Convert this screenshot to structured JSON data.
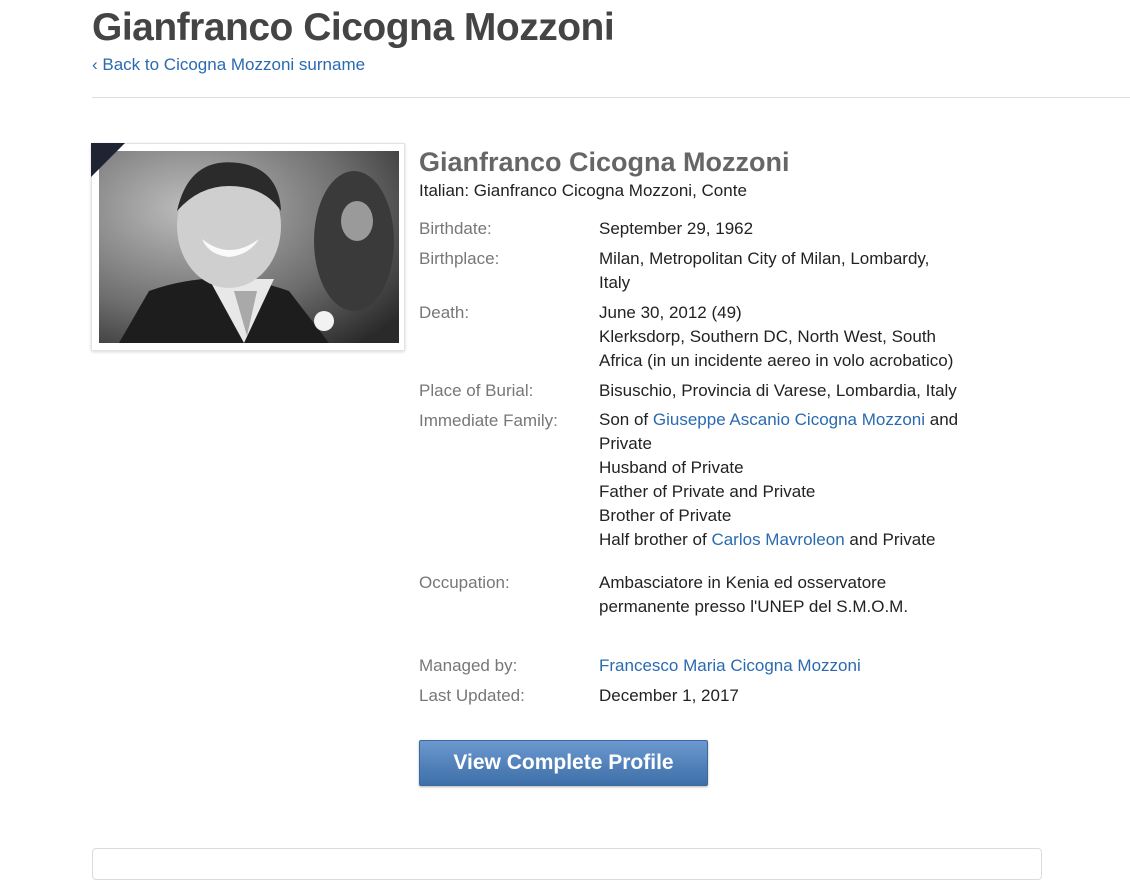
{
  "header": {
    "title": "Gianfranco Cicogna Mozzoni",
    "back_link": "‹ Back to Cicogna Mozzoni surname"
  },
  "profile": {
    "name": "Gianfranco Cicogna Mozzoni",
    "alt_name": "Italian: Gianfranco Cicogna Mozzoni, Conte",
    "photo_icon": "portrait-photo",
    "fields": {
      "birthdate_label": "Birthdate:",
      "birthdate": "September 29, 1962",
      "birthplace_label": "Birthplace:",
      "birthplace_line1": "Milan, Metropolitan City of Milan, Lombardy,",
      "birthplace_line2": "Italy",
      "death_label": "Death:",
      "death_date": "June 30, 2012 (49)",
      "death_place_line1": "Klerksdorp, Southern DC, North West, South",
      "death_place_line2": "Africa (in un incidente aereo in volo acrobatico)",
      "burial_label": "Place of Burial:",
      "burial": "Bisuschio, Provincia di Varese, Lombardia, Italy",
      "family_label": "Immediate Family:",
      "family": {
        "son_prefix": "Son of ",
        "father_link": "Giuseppe Ascanio Cicogna Mozzoni",
        "son_suffix": " and",
        "son_line2": "Private",
        "husband": "Husband of Private",
        "father_of": "Father of Private and Private",
        "brother": "Brother of Private",
        "half_prefix": "Half brother of ",
        "half_link": "Carlos Mavroleon",
        "half_suffix": " and Private"
      },
      "occupation_label": "Occupation:",
      "occupation_line1": "Ambasciatore in Kenia ed osservatore",
      "occupation_line2": "permanente presso l'UNEP del S.M.O.M.",
      "managed_label": "Managed by:",
      "managed_by": "Francesco Maria Cicogna Mozzoni",
      "updated_label": "Last Updated:",
      "updated": "December 1, 2017"
    },
    "view_button": "View Complete Profile"
  },
  "colors": {
    "link": "#2a6ab0",
    "button": "#4f7fba",
    "ribbon": "#1e2431"
  }
}
